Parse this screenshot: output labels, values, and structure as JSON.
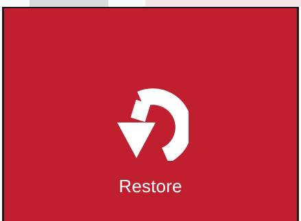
{
  "tile": {
    "label": "Restore",
    "icon": "restore-icon",
    "background_color": "#c01f2f",
    "text_color": "#ffffff"
  }
}
